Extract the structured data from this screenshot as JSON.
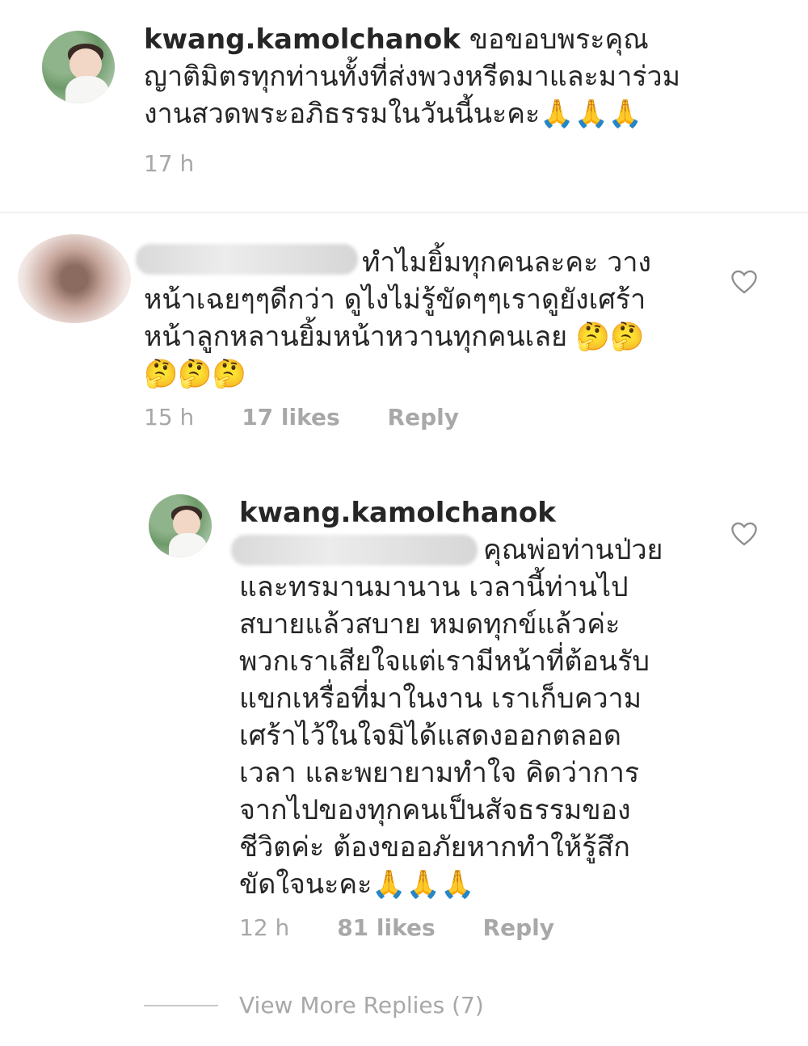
{
  "comment1": {
    "username": "kwang.kamolchanok",
    "text_line1": "ขอขอบพระคุณ",
    "text_line2": "ญาติมิตรทุกท่านทั้งที่ส่งพวงหรีดมาและมาร่วม",
    "text_line3": "งานสวดพระอภิธรรมในวันนี้นะคะ",
    "emoji": "🙏🙏🙏",
    "time": "17 h"
  },
  "comment2": {
    "username_hidden": true,
    "text_line1": "ทำไมยิ้มทุกคนละคะ วาง",
    "text_line2": "หน้าเฉยๆๆดีกว่า ดูไงไม่รู้ขัดๆๆเราดูยังเศร้า",
    "text_line3": "หน้าลูกหลานยิ้มหน้าหวานทุกคนเลย",
    "emoji_line3": "🤔🤔",
    "emoji_line4": "🤔🤔🤔",
    "time": "15 h",
    "likes": "17 likes",
    "reply": "Reply"
  },
  "reply1": {
    "username": "kwang.kamolchanok",
    "lines": [
      "คุณพ่อท่านป่วย",
      "และทรมานมานาน เวลานี้ท่านไป",
      "สบายแล้วสบาย หมดทุกข์แล้วค่ะ",
      "พวกเราเสียใจแต่เรามีหน้าที่ต้อนรับ",
      "แขกเหรื่อที่มาในงาน เราเก็บความ",
      "เศร้าไว้ในใจมิได้แสดงออกตลอด",
      "เวลา และพยายามทำใจ คิดว่าการ",
      "จากไปของทุกคนเป็นสัจธรรมของ",
      "ชีวิตค่ะ ต้องขออภัยหากทำให้รู้สึก",
      "ขัดใจนะคะ"
    ],
    "emoji": "🙏🙏🙏",
    "time": "12 h",
    "likes": "81 likes",
    "reply": "Reply"
  },
  "view_more": "View More Replies (7)",
  "icons": {
    "heart": "heart-icon"
  },
  "colors": {
    "text": "#262626",
    "meta": "#a8a8a8",
    "divider": "#efefef"
  }
}
